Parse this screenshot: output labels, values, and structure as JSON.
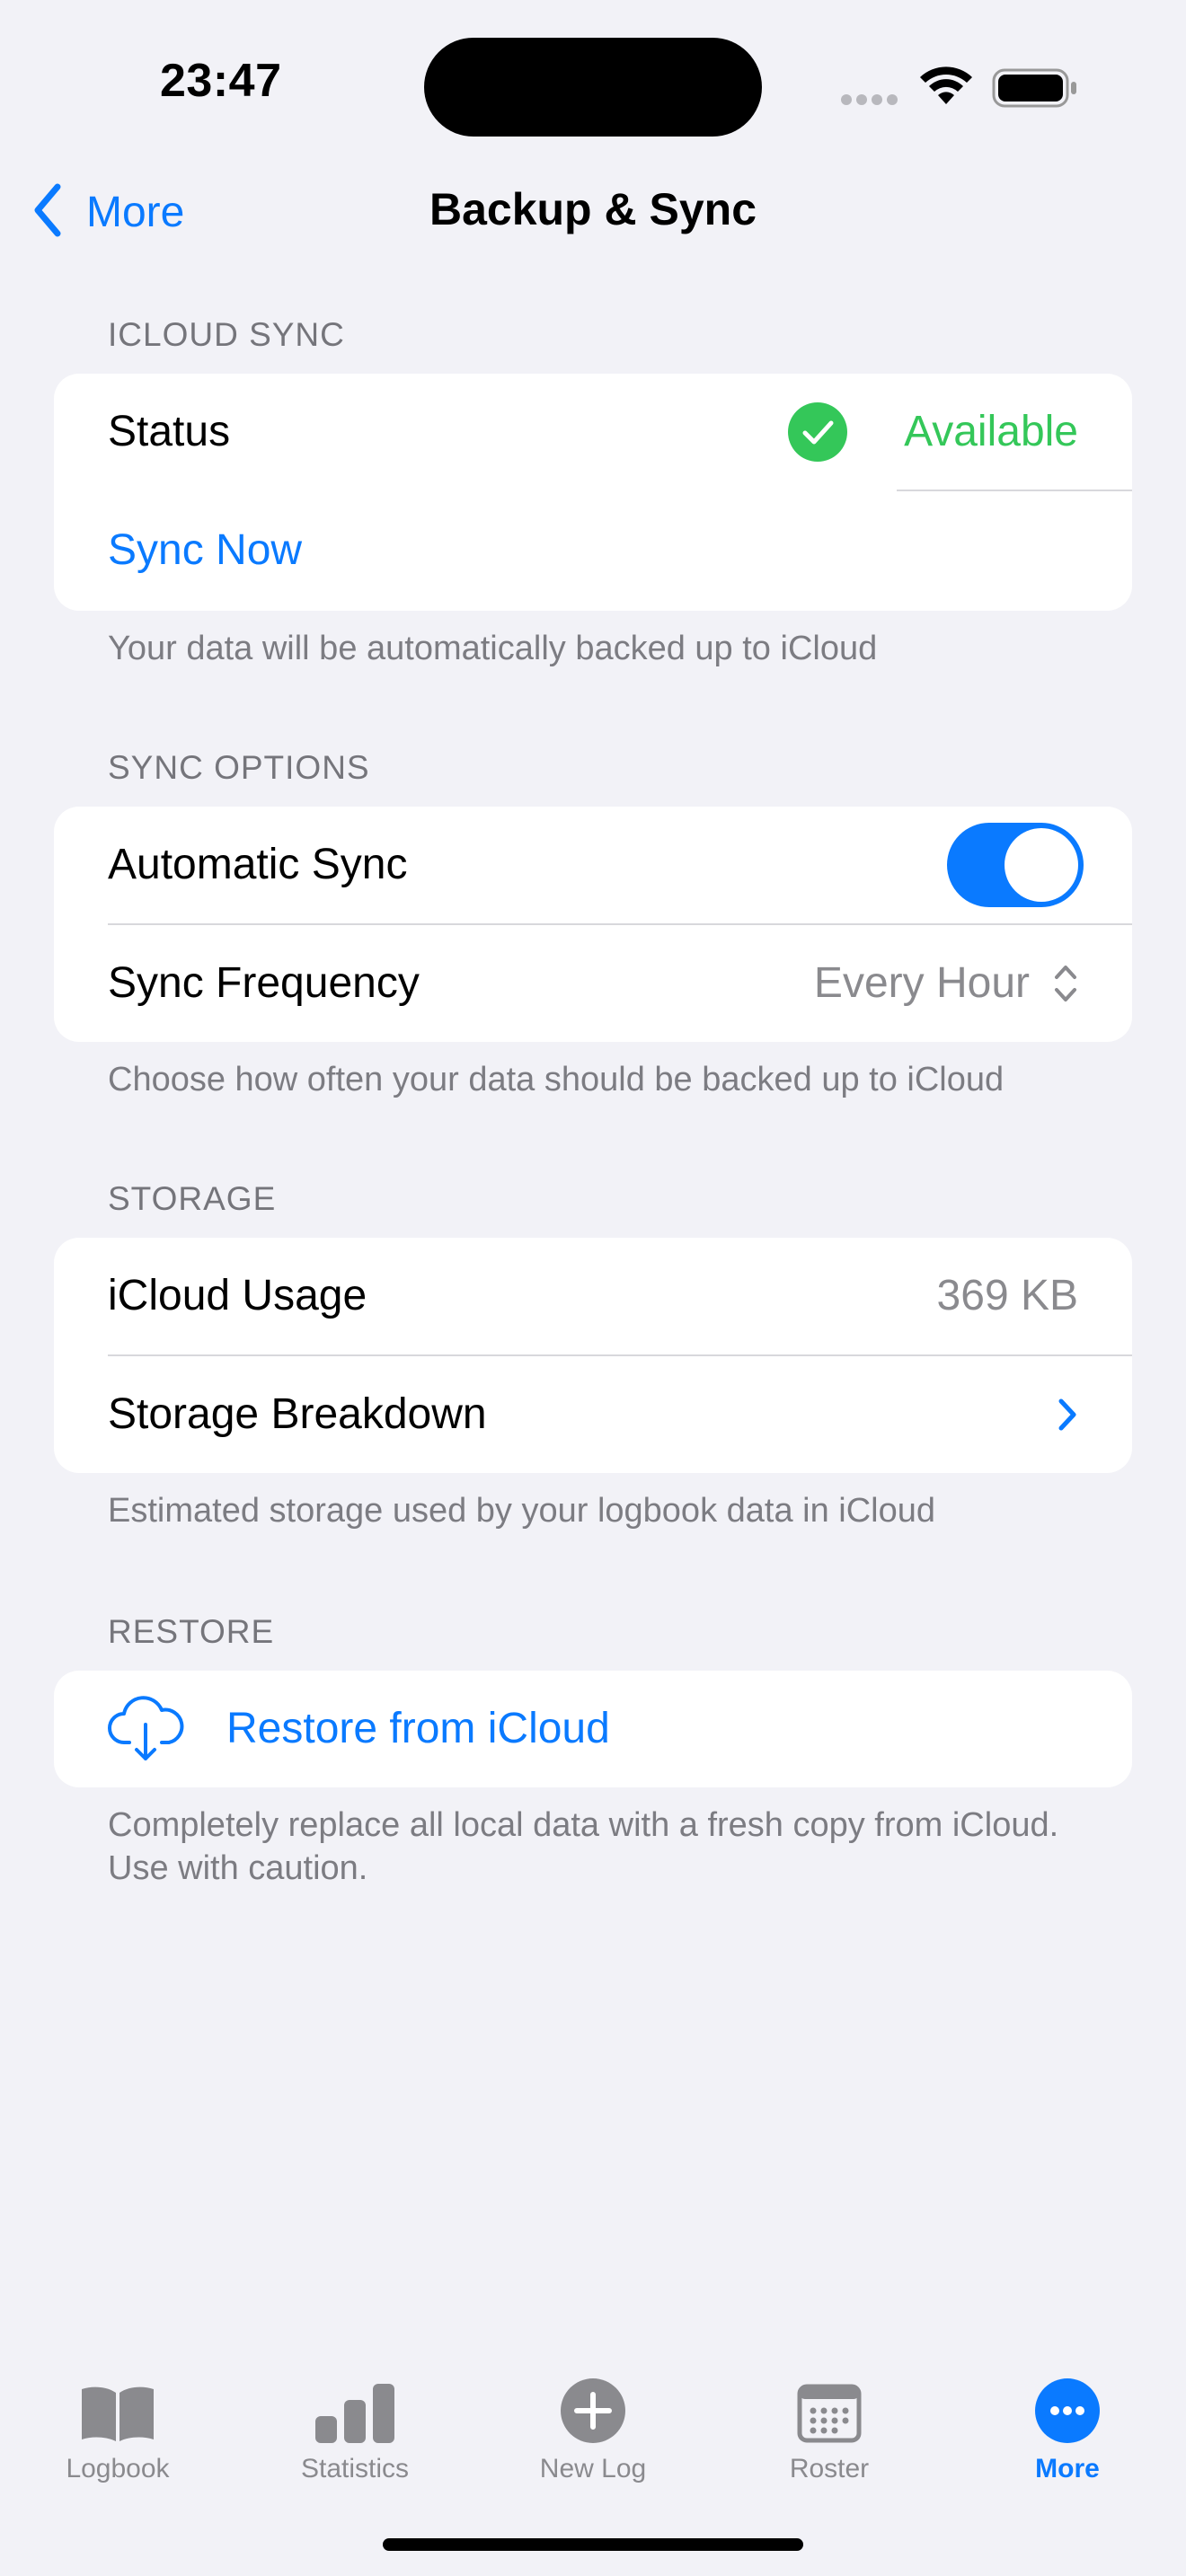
{
  "status_bar": {
    "time": "23:47"
  },
  "nav": {
    "back_label": "More",
    "title": "Backup & Sync"
  },
  "sections": {
    "icloud_sync": {
      "header": "ICLOUD SYNC",
      "status_label": "Status",
      "status_value": "Available",
      "sync_now_label": "Sync Now",
      "footer": "Your data will be automatically backed up to iCloud"
    },
    "sync_options": {
      "header": "SYNC OPTIONS",
      "auto_sync_label": "Automatic Sync",
      "auto_sync_on": true,
      "frequency_label": "Sync Frequency",
      "frequency_value": "Every Hour",
      "footer": "Choose how often your data should be backed up to iCloud"
    },
    "storage": {
      "header": "STORAGE",
      "usage_label": "iCloud Usage",
      "usage_value": "369 KB",
      "breakdown_label": "Storage Breakdown",
      "footer": "Estimated storage used by your logbook data in iCloud"
    },
    "restore": {
      "header": "RESTORE",
      "restore_label": "Restore from iCloud",
      "footer": "Completely replace all local data with a fresh copy from iCloud. Use with caution."
    }
  },
  "tabs": [
    {
      "label": "Logbook",
      "icon": "book-icon"
    },
    {
      "label": "Statistics",
      "icon": "bar-chart-icon"
    },
    {
      "label": "New Log",
      "icon": "plus-circle-icon"
    },
    {
      "label": "Roster",
      "icon": "calendar-icon"
    },
    {
      "label": "More",
      "icon": "ellipsis-circle-icon",
      "active": true
    }
  ],
  "colors": {
    "accent": "#0a7aff",
    "success": "#34c759",
    "background": "#f2f2f7",
    "secondary_text": "#8a8a8e"
  }
}
